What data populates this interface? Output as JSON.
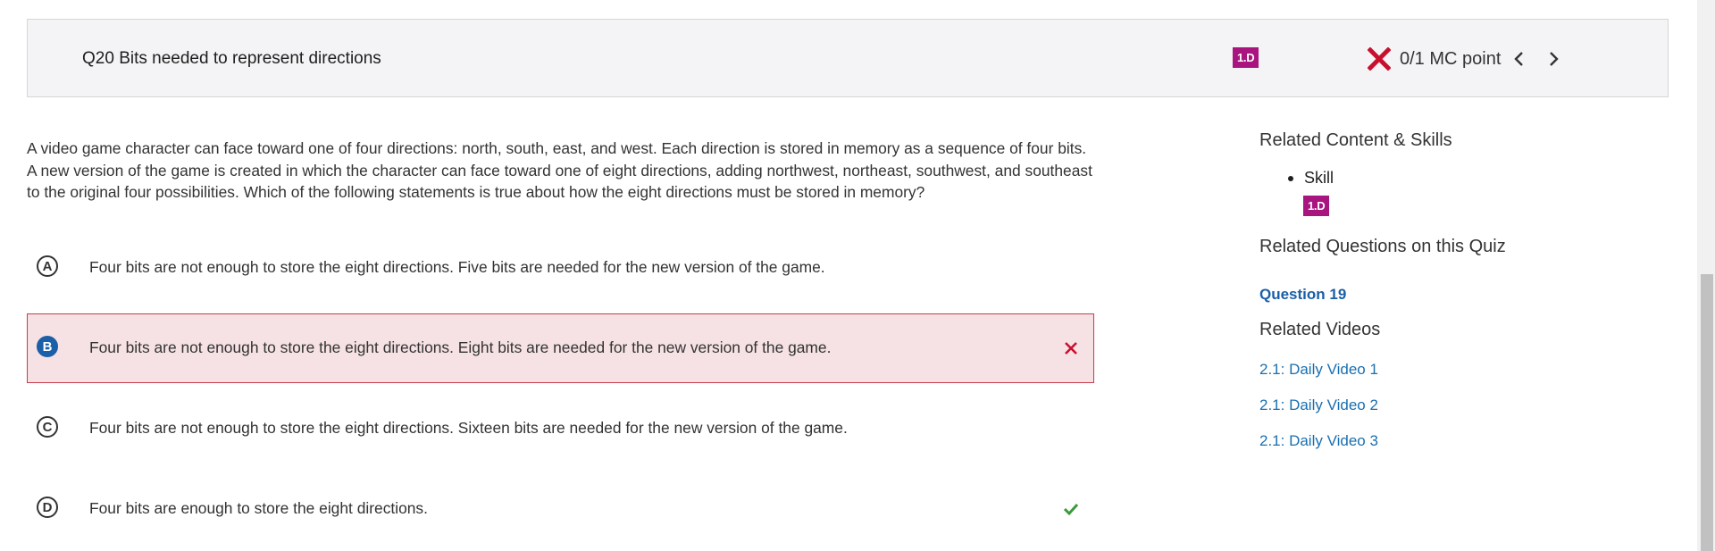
{
  "header": {
    "title": "Q20 Bits needed to represent directions",
    "skill_badge": "1.D",
    "score": "0/1 MC point",
    "prev_icon": "chevron-left-icon",
    "next_icon": "chevron-right-icon",
    "status_icon": "x-icon"
  },
  "question": {
    "stem": "A video game character can face toward one of four directions: north, south, east, and west. Each direction is stored in memory as a sequence of four bits. A new version of the game is created in which the character can face toward one of eight directions, adding northwest, northeast, southwest, and southeast to the original four possibilities. Which of the following statements is true about how the eight directions must be stored in memory?",
    "options": [
      {
        "letter": "A",
        "text": "Four bits are not enough to store the eight directions. Five bits are needed for the new version of the game."
      },
      {
        "letter": "B",
        "text": "Four bits are not enough to store the eight directions. Eight bits are needed for the new version of the game.",
        "state": "selected-incorrect"
      },
      {
        "letter": "C",
        "text": "Four bits are not enough to store the eight directions. Sixteen bits are needed for the new version of the game."
      },
      {
        "letter": "D",
        "text": "Four bits are enough to store the eight directions.",
        "state": "correct"
      }
    ]
  },
  "sidebar": {
    "content_heading": "Related Content & Skills",
    "skill_label": "Skill",
    "skill_badge": "1.D",
    "questions_heading": "Related Questions on this Quiz",
    "question_link": "Question 19",
    "videos_heading": "Related Videos",
    "videos": [
      "2.1: Daily Video 1",
      "2.1: Daily Video 2",
      "2.1: Daily Video 3"
    ]
  },
  "colors": {
    "badge": "#a8157f",
    "incorrect": "#c8102e",
    "correct": "#3a9a3a",
    "link": "#1a6fb0",
    "selected_bg": "#f6e2e4"
  }
}
